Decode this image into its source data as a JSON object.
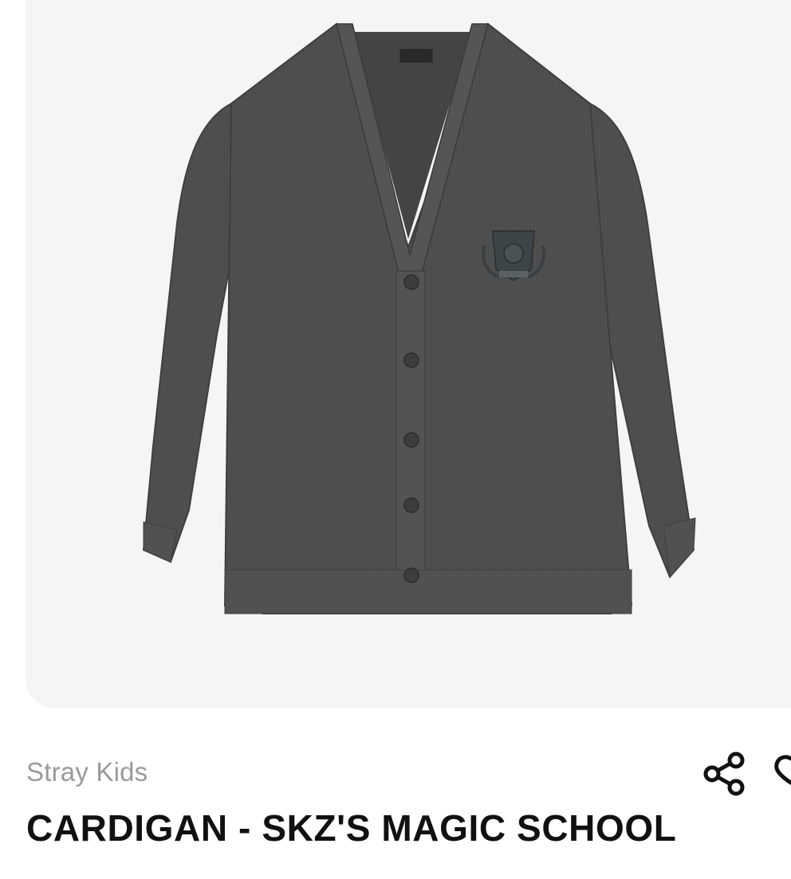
{
  "product": {
    "brand": "Stray Kids",
    "title": "CARDIGAN - SKZ'S MAGIC SCHOOL",
    "image_alt": "Charcoal grey V-neck knit cardigan with crest emblem",
    "garment_color": "#505050",
    "image_background": "#f5f5f5"
  },
  "actions": {
    "share_icon": "share-icon",
    "wishlist_icon": "heart-icon"
  },
  "colors": {
    "brand_text": "#9a9a9a",
    "title_text": "#111111"
  }
}
